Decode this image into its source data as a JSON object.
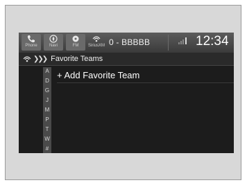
{
  "statusbar": {
    "phone_label": "Phone",
    "navi_label": "Navi",
    "fm_label": "FM",
    "sat_label": "SiriusXM",
    "station": "0 - BBBBB",
    "clock": "12:34",
    "colors": {
      "background": "#1c1c1c",
      "bar": "#4a4a4a",
      "text": "#ffffff"
    }
  },
  "subheader": {
    "icon": "siriusxm-icon",
    "chevrons": "❯❯❯",
    "title": "Favorite Teams"
  },
  "alpha_index": [
    "A",
    "D",
    "G",
    "J",
    "M",
    "P",
    "T",
    "W",
    "#"
  ],
  "list": {
    "items": [
      {
        "label": "+ Add Favorite Team"
      }
    ]
  }
}
